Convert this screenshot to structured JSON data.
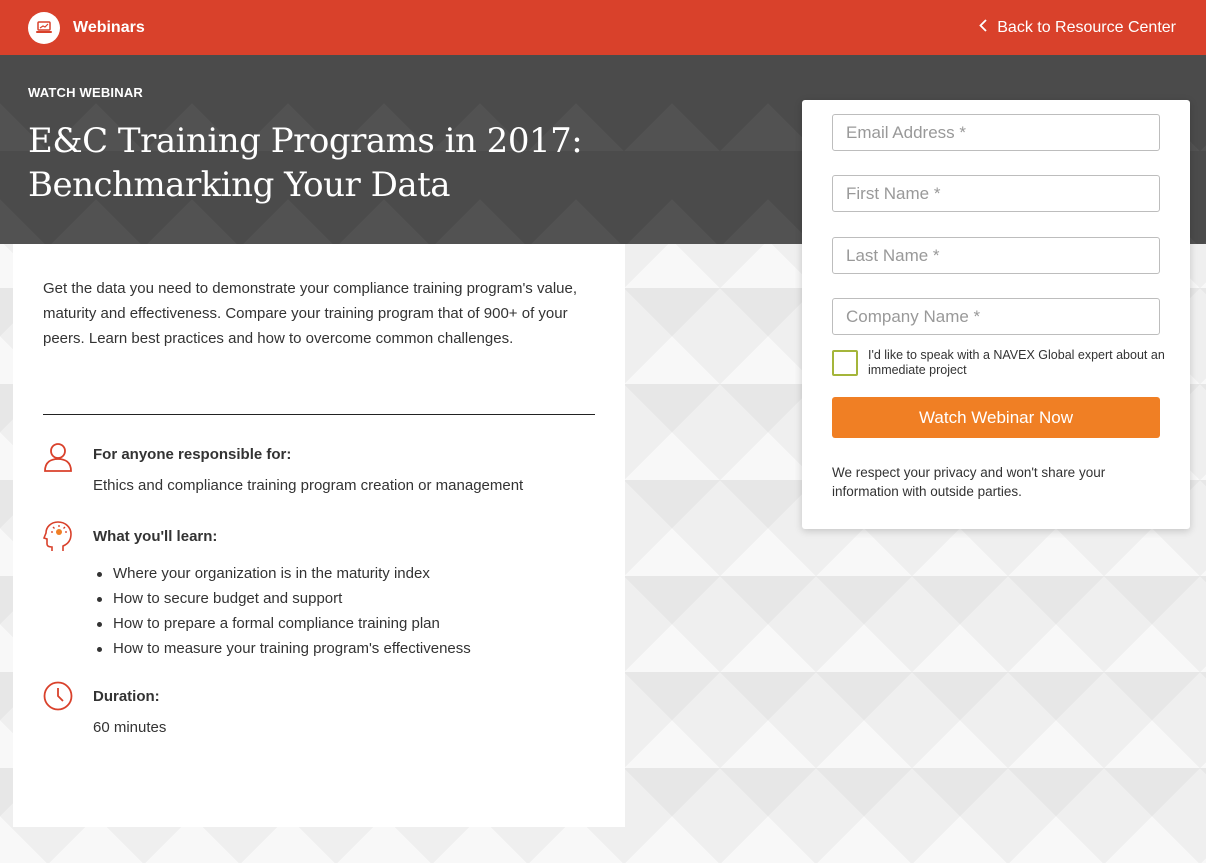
{
  "header": {
    "brand_label": "Webinars",
    "brand_icon": "laptop-icon",
    "back_label": "Back to Resource Center",
    "back_icon": "chevron-left-icon",
    "accent_color": "#d9412b"
  },
  "hero": {
    "eyebrow": "WATCH WEBINAR",
    "title_line1": "E&C Training Programs in 2017:",
    "title_line2": "Benchmarking Your Data"
  },
  "content": {
    "intro": "Get the data you need to demonstrate your compliance training program's value, maturity and effectiveness. Compare your training program that of 900+ of your peers. Learn best practices and how to overcome common challenges.",
    "audience": {
      "icon": "person-icon",
      "heading": "For anyone responsible for:",
      "text": "Ethics and compliance training program creation or management"
    },
    "learn": {
      "icon": "head-lightbulb-icon",
      "heading": "What you'll learn:",
      "items": [
        "Where your organization is in the maturity index",
        "How to secure budget and support",
        "How to prepare a formal compliance training plan",
        "How to measure your training program's effectiveness"
      ]
    },
    "duration": {
      "icon": "clock-icon",
      "heading": "Duration:",
      "text": "60 minutes"
    }
  },
  "form": {
    "email_placeholder": "Email Address *",
    "first_name_placeholder": "First Name *",
    "last_name_placeholder": "Last Name *",
    "company_placeholder": "Company Name *",
    "checkbox_label": "I'd like to speak with a NAVEX Global expert about an immediate project",
    "submit_label": "Watch Webinar Now",
    "privacy": "We respect your privacy and won't share your information with outside parties.",
    "button_color": "#f07f24"
  }
}
